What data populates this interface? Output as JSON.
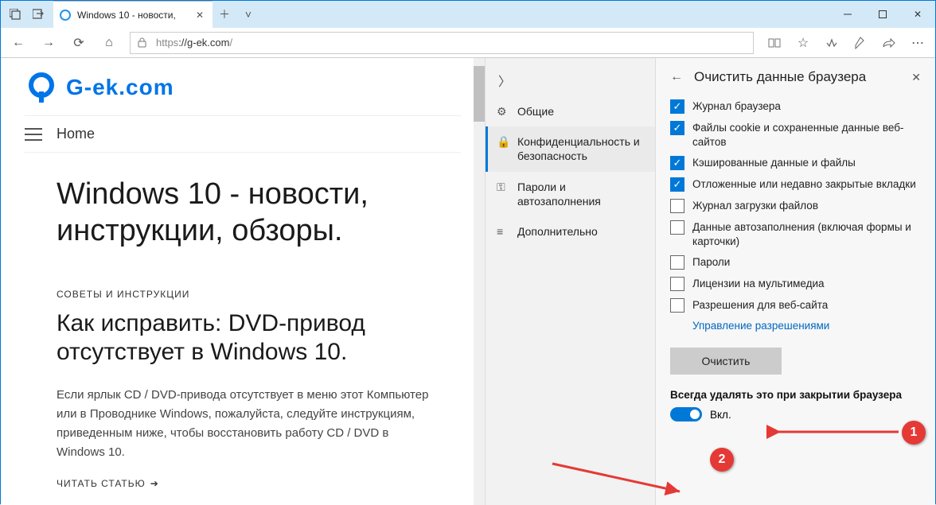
{
  "tab": {
    "title": "Windows 10 - новости,"
  },
  "address": {
    "protocol": "https",
    "host": "://g-ek.com",
    "rest": "/"
  },
  "page": {
    "logo_text": "G-ek.com",
    "home": "Home",
    "h1": "Windows 10 - новости, инструкции, обзоры.",
    "overline": "СОВЕТЫ И ИНСТРУКЦИИ",
    "h2": "Как исправить: DVD-привод отсутствует в Windows 10.",
    "body": "Если ярлык CD / DVD-привода отсутствует в меню этот Компьютер или в Проводнике Windows, пожалуйста, следуйте инструкциям, приведенным ниже, чтобы восстановить работу CD / DVD в Windows 10.",
    "read_more": "ЧИТАТЬ СТАТЬЮ"
  },
  "settings": {
    "items": [
      {
        "icon": "⚙",
        "label": "Общие"
      },
      {
        "icon": "🔒",
        "label": "Конфиденциальность и безопасность"
      },
      {
        "icon": "🔑",
        "label": "Пароли и автозаполнения"
      },
      {
        "icon": "⚙",
        "label": "Дополнительно"
      }
    ]
  },
  "panel": {
    "title": "Очистить данные браузера",
    "options": [
      {
        "checked": true,
        "label": "Журнал браузера"
      },
      {
        "checked": true,
        "label": "Файлы cookie и сохраненные данные веб-сайтов"
      },
      {
        "checked": true,
        "label": "Кэшированные данные и файлы"
      },
      {
        "checked": true,
        "label": "Отложенные или недавно закрытые вкладки"
      },
      {
        "checked": false,
        "label": "Журнал загрузки файлов"
      },
      {
        "checked": false,
        "label": "Данные автозаполнения (включая формы и карточки)"
      },
      {
        "checked": false,
        "label": "Пароли"
      },
      {
        "checked": false,
        "label": "Лицензии на мультимедиа"
      },
      {
        "checked": false,
        "label": "Разрешения для веб-сайта"
      }
    ],
    "manage_link": "Управление разрешениями",
    "clear_button": "Очистить",
    "always_label": "Всегда удалять это при закрытии браузера",
    "toggle_label": "Вкл."
  },
  "annotations": {
    "one": "1",
    "two": "2"
  }
}
